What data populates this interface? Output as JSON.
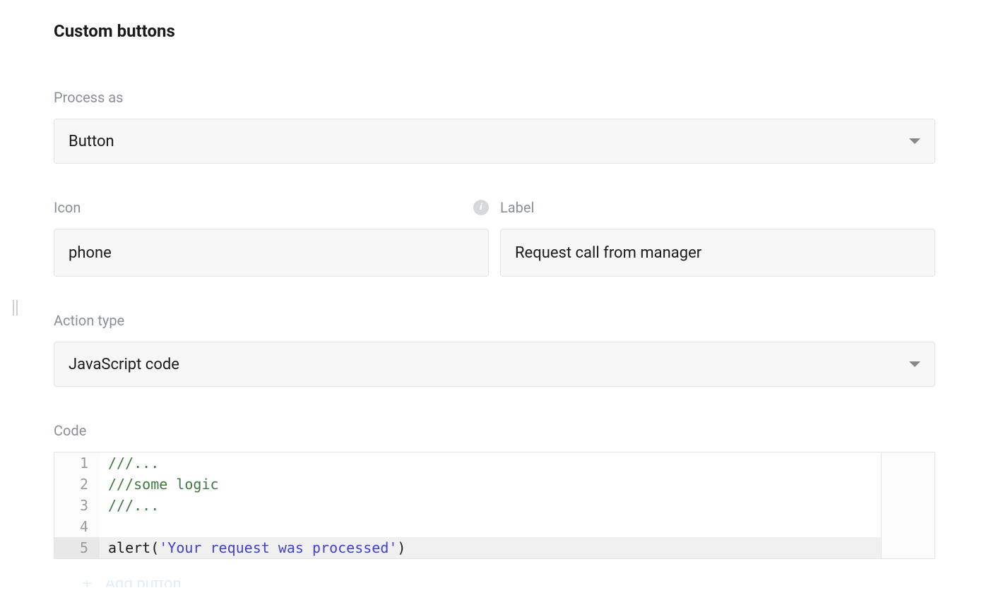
{
  "section": {
    "title": "Custom buttons"
  },
  "fields": {
    "process_as": {
      "label": "Process as",
      "value": "Button"
    },
    "icon": {
      "label": "Icon",
      "value": "phone"
    },
    "button_label": {
      "label": "Label",
      "value": "Request call from manager"
    },
    "action_type": {
      "label": "Action type",
      "value": "JavaScript code"
    },
    "code": {
      "label": "Code",
      "lines": [
        {
          "n": 1,
          "comment": "///..."
        },
        {
          "n": 2,
          "comment": "///some logic"
        },
        {
          "n": 3,
          "comment": "///..."
        },
        {
          "n": 4,
          "comment": ""
        },
        {
          "n": 5,
          "func": "alert",
          "string": "'Your request was processed'"
        }
      ]
    }
  },
  "actions": {
    "add_button": "Add button"
  }
}
